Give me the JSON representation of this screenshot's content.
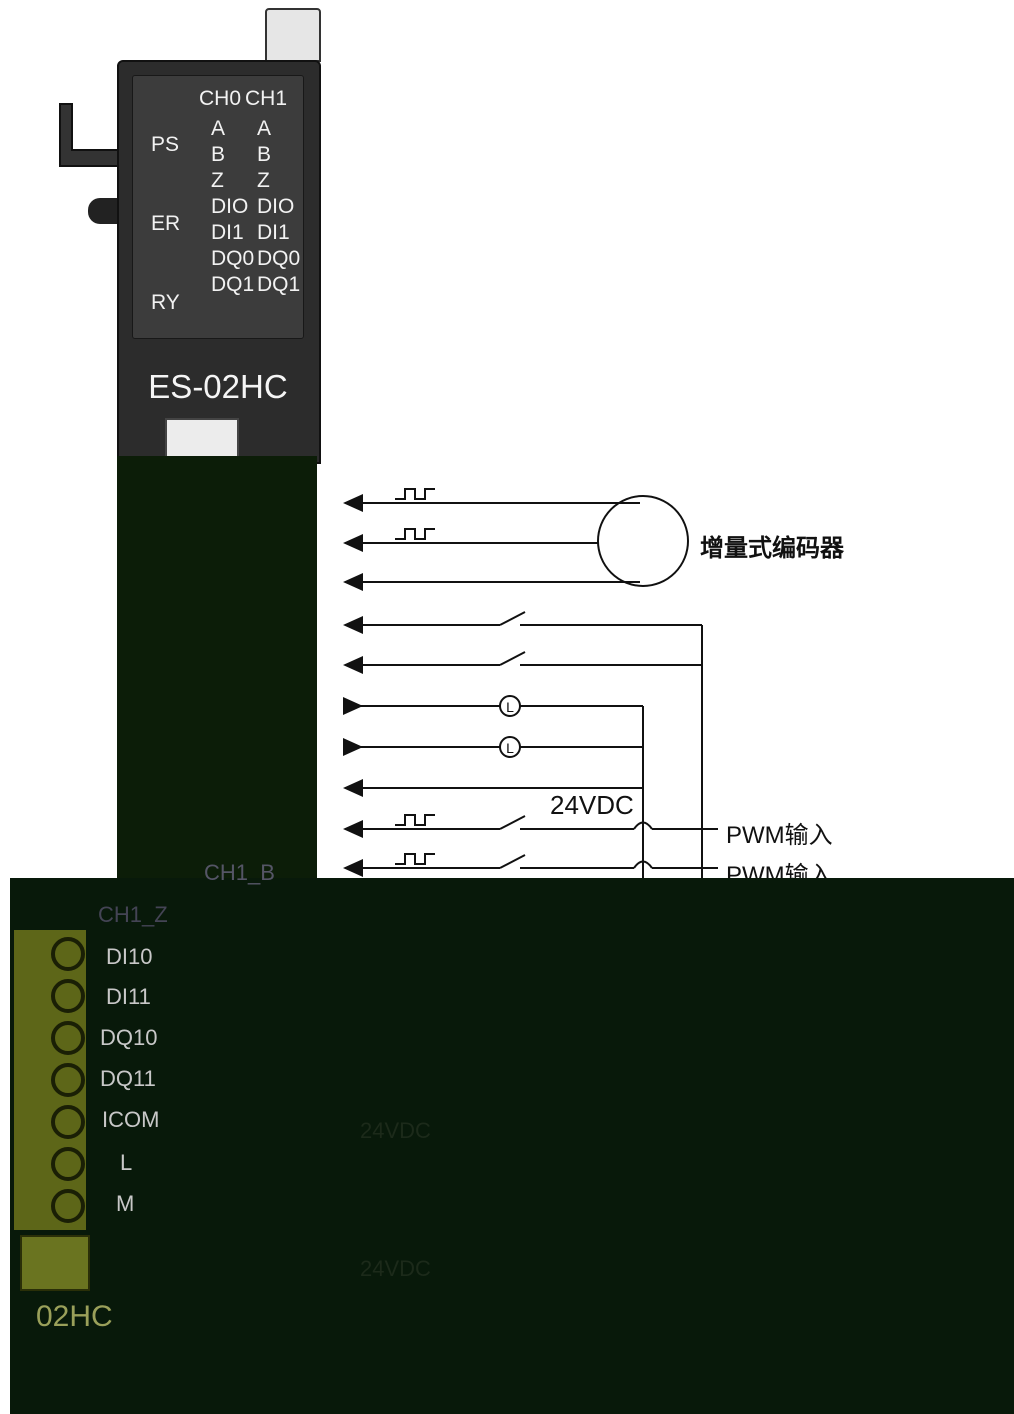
{
  "module": {
    "model": "ES-02HC",
    "bottom_model": "02HC",
    "status_leds": [
      "PS",
      "ER",
      "RY"
    ],
    "channel_headers": [
      "CH0",
      "CH1"
    ],
    "ch0_signals": [
      "A",
      "B",
      "Z",
      "DIO",
      "DI1",
      "DQ0",
      "DQ1"
    ],
    "ch1_signals": [
      "A",
      "B",
      "Z",
      "DIO",
      "DI1",
      "DQ0",
      "DQ1"
    ]
  },
  "wiring": {
    "encoder_label": "增量式编码器",
    "supply_label": "24VDC",
    "pwm_label_1": "PWM输入",
    "pwm_label_2": "PWM输入",
    "load_symbol": "L"
  },
  "terminals": {
    "labels": [
      "CH1_B",
      "CH1_Z",
      "DI10",
      "DI11",
      "DQ10",
      "DQ11",
      "ICOM",
      "L",
      "M"
    ]
  },
  "faded_labels": [
    "24VDC",
    "24VDC"
  ],
  "colors": {
    "module_body": "#2c2c2c",
    "led_panel": "#3c3c3c",
    "overlay_dark": "#08190a",
    "terminal_yellow": "#5d6618",
    "wire": "#111111"
  }
}
